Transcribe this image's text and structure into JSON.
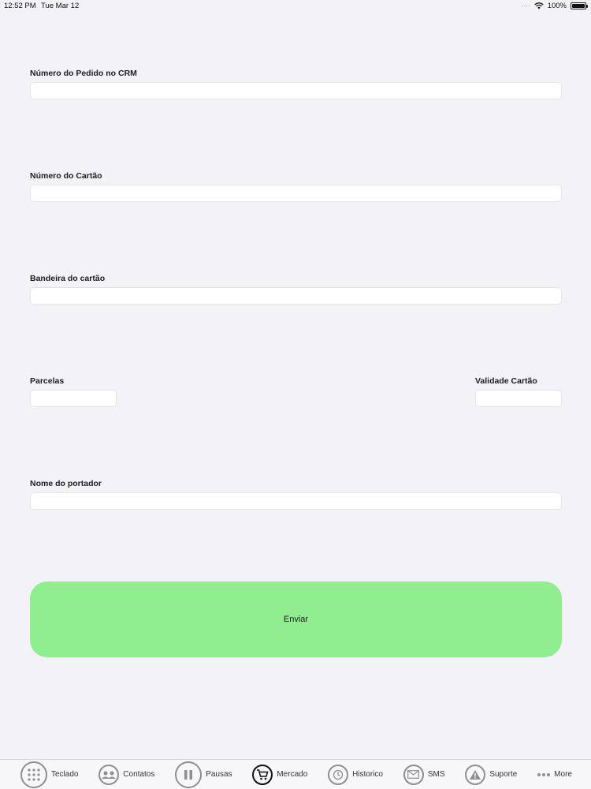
{
  "status_bar": {
    "time": "12:52 PM",
    "date": "Tue Mar 12",
    "battery": "100%",
    "battery_level": 1.0
  },
  "form": {
    "order_number": {
      "label": "Número do Pedido no CRM",
      "value": ""
    },
    "card_number": {
      "label": "Número do Cartão",
      "value": ""
    },
    "card_brand": {
      "label": "Bandeira do cartão",
      "value": ""
    },
    "installments": {
      "label": "Parcelas",
      "value": ""
    },
    "card_expiry": {
      "label": "Validade Cartão",
      "value": ""
    },
    "holder_name": {
      "label": "Nome do portador",
      "value": ""
    },
    "submit_label": "Enviar",
    "submit_color": "#90ee90"
  },
  "tab_bar": {
    "items": [
      {
        "label": "Teclado",
        "icon": "keypad-icon"
      },
      {
        "label": "Contatos",
        "icon": "contacts-icon"
      },
      {
        "label": "Pausas",
        "icon": "pause-icon"
      },
      {
        "label": "Mercado",
        "icon": "cart-icon",
        "active": true
      },
      {
        "label": "Historico",
        "icon": "history-icon"
      },
      {
        "label": "SMS",
        "icon": "envelope-icon"
      },
      {
        "label": "Suporte",
        "icon": "warning-icon"
      },
      {
        "label": "More",
        "icon": "more-icon"
      }
    ]
  }
}
